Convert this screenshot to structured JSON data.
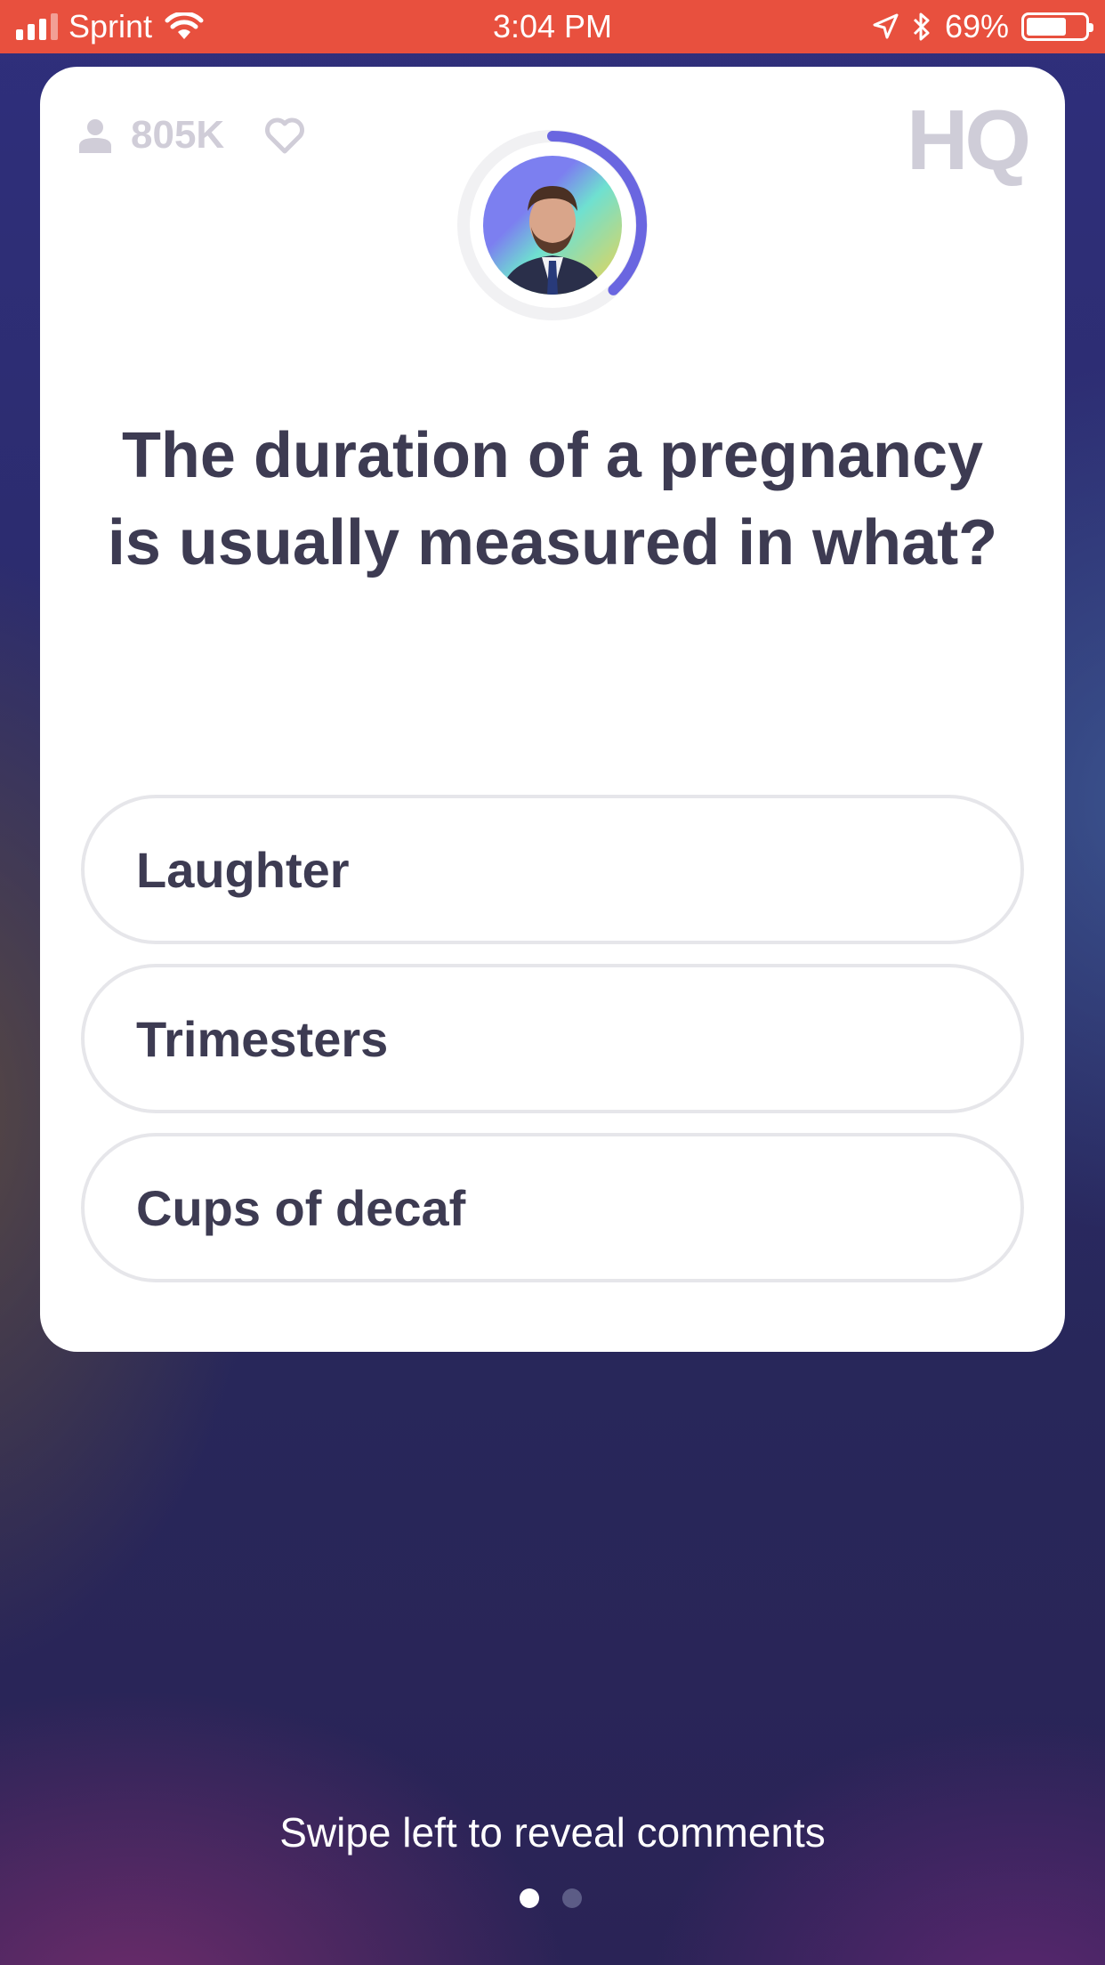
{
  "status_bar": {
    "carrier": "Sprint",
    "time": "3:04 PM",
    "battery": "69%",
    "battery_level": 0.69,
    "icons": [
      "signal-icon",
      "wifi-icon",
      "location-icon",
      "bluetooth-icon",
      "battery-icon"
    ]
  },
  "card": {
    "viewer_count": "805K",
    "logo": "HQ",
    "timer_progress": 0.38,
    "question": "The duration of a pregnancy is usually measured in what?",
    "answers": [
      {
        "label": "Laughter"
      },
      {
        "label": "Trimesters"
      },
      {
        "label": "Cups of decaf"
      }
    ]
  },
  "footer": {
    "swipe_hint": "Swipe left to reveal comments",
    "page_count": 2,
    "active_page": 1
  },
  "colors": {
    "status_bar": "#e8503e",
    "timer_arc": "#6a66e0",
    "text_dark": "#3d3b52",
    "muted": "#d0cdd8",
    "answer_border": "#e6e6ea"
  }
}
